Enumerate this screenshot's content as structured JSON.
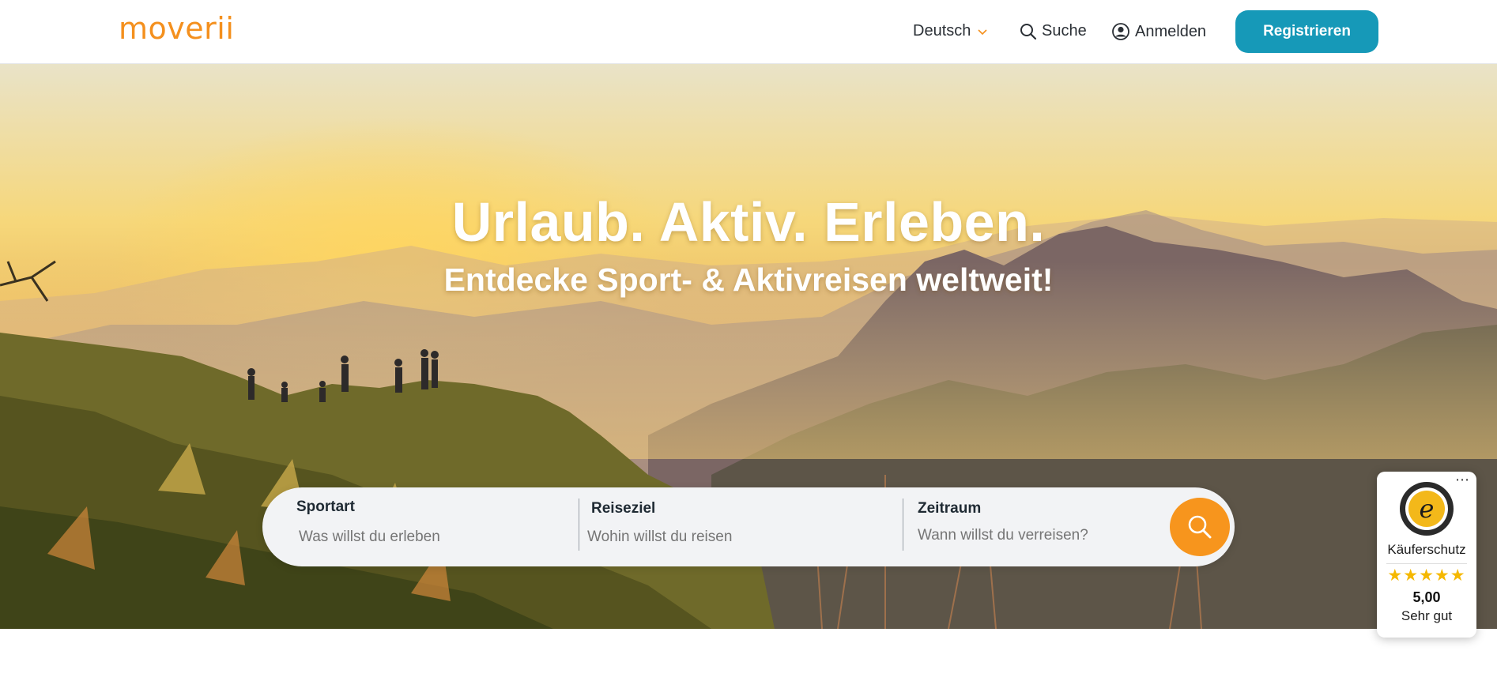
{
  "header": {
    "logo": "moverii",
    "language": "Deutsch",
    "search_label": "Suche",
    "login_label": "Anmelden",
    "register_label": "Registrieren"
  },
  "hero": {
    "title": "Urlaub. Aktiv. Erleben.",
    "subtitle": "Entdecke Sport- & Aktivreisen weltweit!"
  },
  "search": {
    "sport_label": "Sportart",
    "sport_placeholder": "Was willst du erleben",
    "destination_label": "Reiseziel",
    "destination_placeholder": "Wohin willst du reisen",
    "period_label": "Zeitraum",
    "period_placeholder": "Wann willst du verreisen?"
  },
  "trust_badge": {
    "label": "Käuferschutz",
    "stars": "★★★★★",
    "score": "5,00",
    "rating_text": "Sehr gut",
    "more_icon": "⋯"
  },
  "colors": {
    "brand_orange": "#f4901e",
    "brand_teal": "#1699b8",
    "search_button": "#f7951d"
  },
  "icons": [
    "chevron-down-icon",
    "search-icon",
    "user-circle-icon",
    "trusted-shops-seal-icon",
    "more-dots-icon"
  ]
}
